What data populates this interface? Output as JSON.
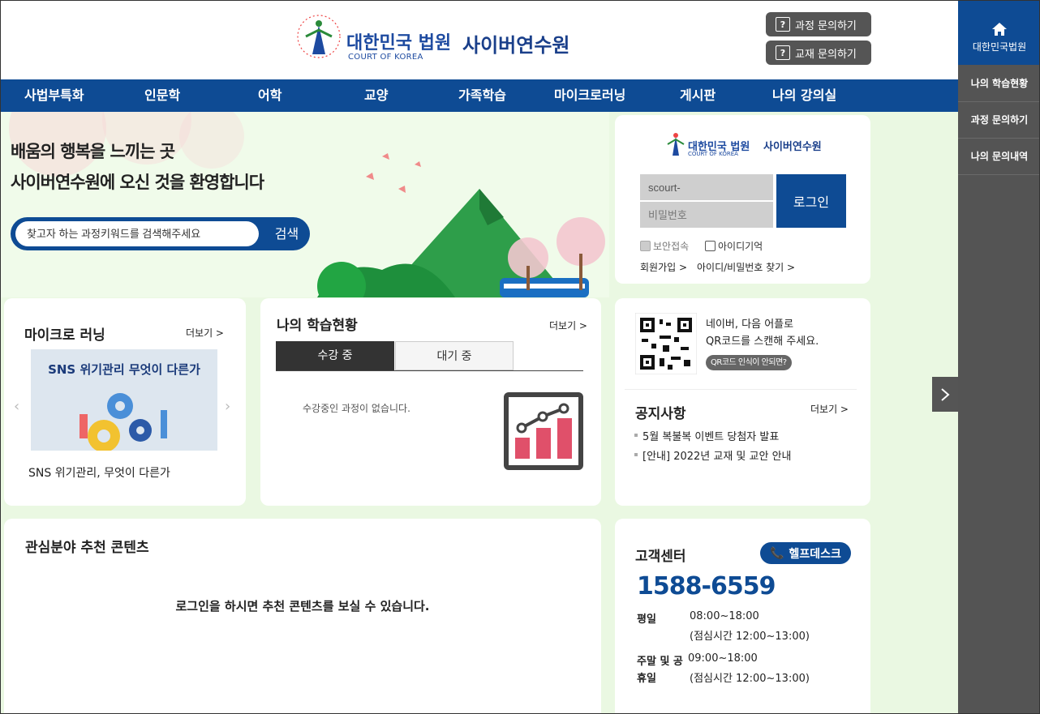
{
  "header": {
    "logo_ko": "대한민국 법원",
    "logo_en": "COURT OF KOREA",
    "logo_site": "사이버연수원",
    "course_inquiry": "과정 문의하기",
    "textbook_inquiry": "교재 문의하기"
  },
  "nav": [
    "사법부특화",
    "인문학",
    "어학",
    "교양",
    "가족학습",
    "마이크로러닝",
    "게시판",
    "나의 강의실"
  ],
  "sidebar": {
    "home_label": "대한민국법원",
    "items": [
      "나의 학습현황",
      "과정 문의하기",
      "나의 문의내역"
    ]
  },
  "hero": {
    "line1": "배움의 행복을 느끼는 곳",
    "line2": "사이버연수원에 오신 것을 환영합니다",
    "search_placeholder": "찾고자 하는 과정키워드를 검색해주세요",
    "search_button": "검색"
  },
  "login": {
    "logo_ko": "대한민국 법원",
    "logo_en": "COURT OF KOREA",
    "logo_site": "사이버연수원",
    "id_value": "scourt-",
    "pw_placeholder": "비밀번호",
    "login_button": "로그인",
    "secure_label": "보안접속",
    "remember_label": "아이디기억",
    "signup_link": "회원가입 >",
    "find_link": "아이디/비밀번호 찾기 >"
  },
  "micro": {
    "title": "마이크로 러닝",
    "more": "더보기 >",
    "thumb_text": "SNS 위기관리 무엇이 다른가",
    "caption": "SNS 위기관리, 무엇이 다른가"
  },
  "status": {
    "title": "나의 학습현황",
    "more": "더보기 >",
    "tab_active": "수강 중",
    "tab_waiting": "대기 중",
    "empty_text": "수강중인 과정이 없습니다."
  },
  "qr": {
    "line1": "네이버, 다음 어플로",
    "line2": "QR코드를 스캔해 주세요.",
    "help_pill": "QR코드 인식이 안되면?"
  },
  "notice": {
    "title": "공지사항",
    "more": "더보기 >",
    "items": [
      "5월 복불복 이벤트 당첨자 발표",
      "[안내] 2022년 교재 및 교안 안내"
    ]
  },
  "recommend": {
    "title": "관심분야 추천 콘텐츠",
    "message": "로그인을 하시면 추천 콘텐츠를 보실 수 있습니다."
  },
  "support": {
    "title": "고객센터",
    "helpdesk": "헬프데스크",
    "phone": "1588-6559",
    "weekday_label": "평일",
    "weekday_hours": "08:00~18:00",
    "weekday_lunch": "(점심시간 12:00~13:00)",
    "weekend_label1": "주말 및 공",
    "weekend_label2": "휴일",
    "weekend_hours": "09:00~18:00",
    "weekend_lunch": "(점심시간 12:00~13:00)"
  },
  "colors": {
    "brand": "#0e4b94",
    "sidebar": "#545454",
    "page_bg": "#eaf8e2",
    "chart_icon": "#e0506a"
  }
}
